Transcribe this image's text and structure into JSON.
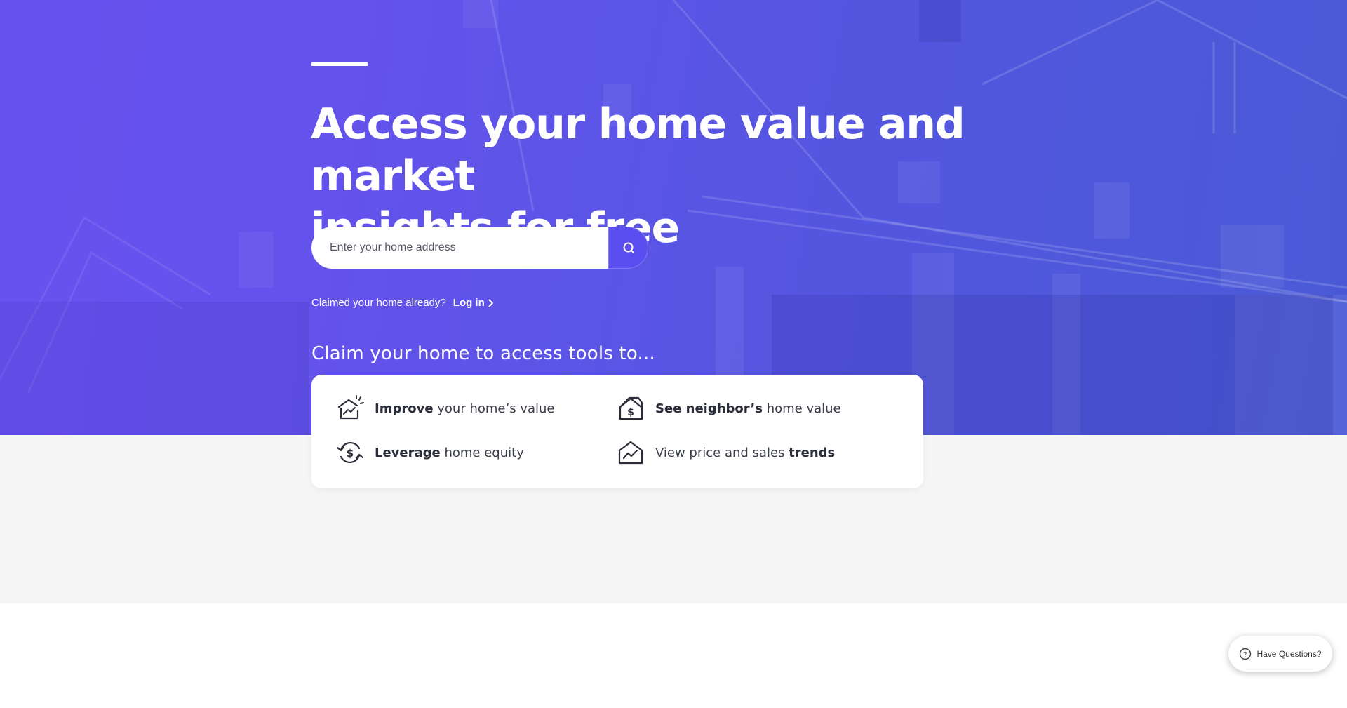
{
  "hero": {
    "headline_line1": "Access your home value and market",
    "headline_line2": "insights for free",
    "search": {
      "placeholder": "Enter your home address",
      "button_icon": "search-icon"
    },
    "claimed_text": "Claimed your home already?",
    "login_label": "Log in",
    "login_icon": "chevron-right-icon"
  },
  "tools": {
    "title": "Claim your home to access tools to...",
    "items": [
      {
        "icon": "home-growth-icon",
        "bold": "Improve",
        "rest": " your home’s value"
      },
      {
        "icon": "home-dollar-icon",
        "bold": "See neighbor’s",
        "rest": " home value"
      },
      {
        "icon": "dollar-cycle-icon",
        "bold": "Leverage",
        "rest": " home equity"
      },
      {
        "icon": "home-trend-icon",
        "prefix": "View price and sales ",
        "bold": "trends"
      }
    ]
  },
  "help_widget": {
    "label": "Have Questions?",
    "icon": "question-circle-icon"
  },
  "colors": {
    "hero_purple": "#5f54e8",
    "search_button": "#5b4ef0",
    "gray_band": "#f5f5f5",
    "icon_dark": "#2b2e3a"
  }
}
